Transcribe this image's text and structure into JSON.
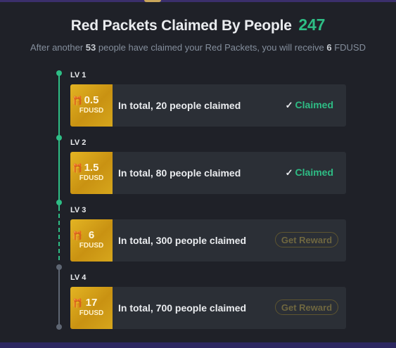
{
  "header": {
    "title": "Red Packets Claimed By People",
    "count": "247",
    "subtitle_prefix": "After another",
    "people_needed": "53",
    "subtitle_middle": "people have claimed your Red Packets, you will receive",
    "reward_amount": "6",
    "reward_currency": "FDUSD"
  },
  "levels": [
    {
      "label": "LV 1",
      "amount": "0.5",
      "currency": "FDUSD",
      "description": "In total, 20 people claimed",
      "status": "Claimed"
    },
    {
      "label": "LV 2",
      "amount": "1.5",
      "currency": "FDUSD",
      "description": "In total, 80 people claimed",
      "status": "Claimed"
    },
    {
      "label": "LV 3",
      "amount": "6",
      "currency": "FDUSD",
      "description": "In total, 300 people claimed",
      "button": "Get Reward"
    },
    {
      "label": "LV 4",
      "amount": "17",
      "currency": "FDUSD",
      "description": "In total, 700 people claimed",
      "button": "Get Reward"
    }
  ],
  "colors": {
    "background": "#1f2128",
    "card": "#2b2f36",
    "accent_green": "#2ebd85",
    "coupon_gold": "#d4a418",
    "timeline_inactive": "#5e6673"
  },
  "icons": {
    "check": "check-icon",
    "gift": "gift-icon"
  }
}
